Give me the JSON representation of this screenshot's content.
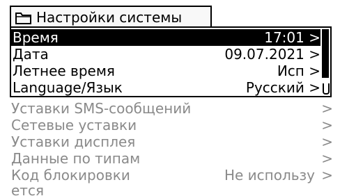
{
  "header": {
    "title": "Настройки системы",
    "icon": "folder-icon"
  },
  "menu": {
    "items": [
      {
        "label": "Время",
        "value": "17:01 >",
        "selected": true
      },
      {
        "label": "Дата",
        "value": "09.07.2021 >",
        "selected": false
      },
      {
        "label": "Летнее время",
        "value": "Исп >",
        "selected": false
      },
      {
        "label": "Language/Язык",
        "value": "Русский >",
        "selected": false
      }
    ]
  },
  "more_items": [
    {
      "label": "Уставки SMS-сообщений",
      "arrow": ">"
    },
    {
      "label": "Сетевые уставки",
      "arrow": ">"
    },
    {
      "label": "Уставки дисплея",
      "arrow": ">"
    },
    {
      "label": "Данные по типам",
      "arrow": ">"
    },
    {
      "label": "Код блокировки",
      "value": "Не использу",
      "arrow": ">",
      "continuation": "ется"
    }
  ],
  "colors": {
    "selected_bg": "#000000",
    "selected_fg": "#ffffff",
    "text": "#000000",
    "disabled_text": "#8a8a8a"
  }
}
